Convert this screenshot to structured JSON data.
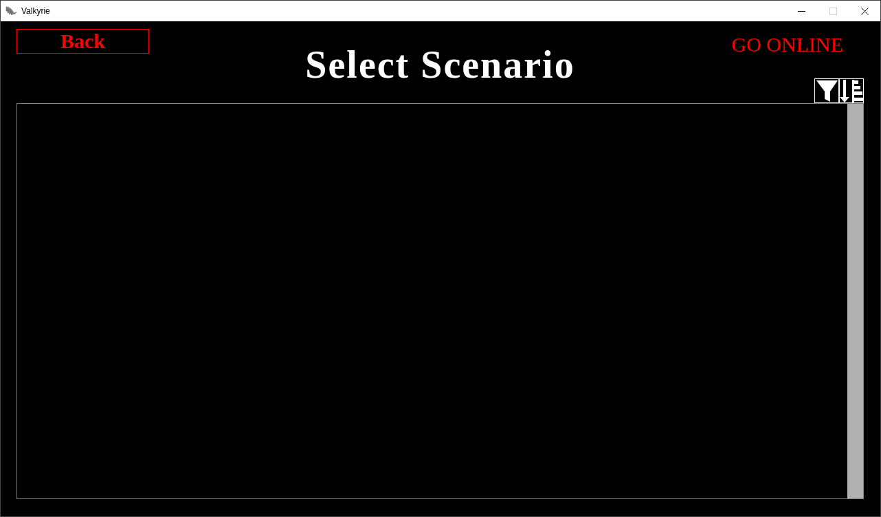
{
  "window": {
    "title": "Valkyrie",
    "controls": [
      {
        "kind": "minimize",
        "disabled": false
      },
      {
        "kind": "maximize",
        "disabled": true
      },
      {
        "kind": "close",
        "disabled": false
      }
    ]
  },
  "back_button": {
    "label": "Back"
  },
  "heading": "Select Scenario",
  "online_button": {
    "label": "GO ONLINE"
  },
  "tools": [
    {
      "kind": "filter"
    },
    {
      "kind": "sort"
    }
  ]
}
